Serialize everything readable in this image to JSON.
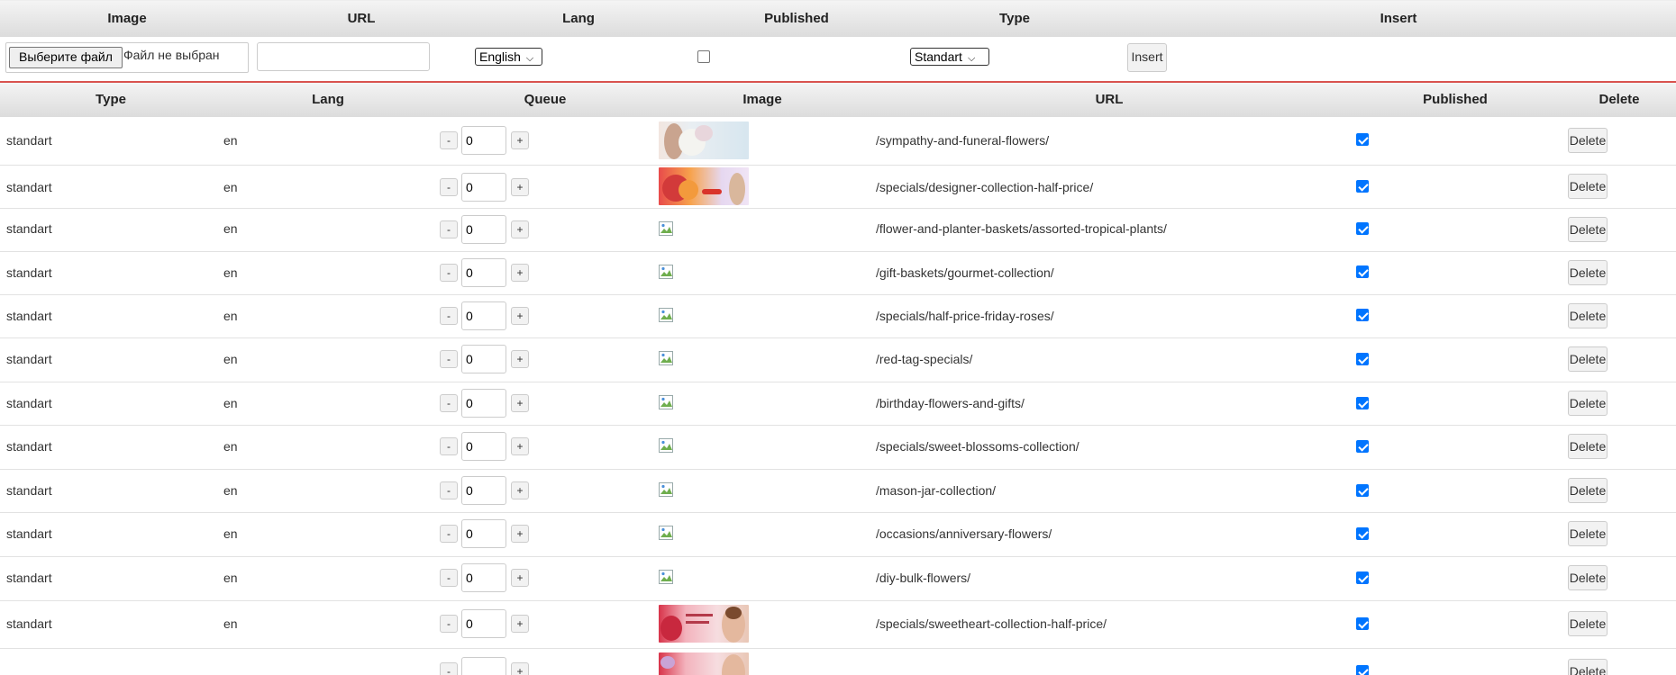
{
  "insert_form": {
    "headers": {
      "image": "Image",
      "url": "URL",
      "lang": "Lang",
      "published": "Published",
      "type": "Type",
      "insert": "Insert"
    },
    "file_button_label": "Выберите файл",
    "file_status": "Файл не выбран",
    "url_value": "",
    "lang_selected": "English",
    "published_checked": false,
    "type_selected": "Standart",
    "insert_button_label": "Insert"
  },
  "list": {
    "headers": {
      "type": "Type",
      "lang": "Lang",
      "queue": "Queue",
      "image": "Image",
      "url": "URL",
      "published": "Published",
      "delete": "Delete"
    },
    "minus_label": "-",
    "plus_label": "+",
    "delete_label": "Delete",
    "rows": [
      {
        "type": "standart",
        "lang": "en",
        "queue": "0",
        "image": "thumb-sympathy",
        "url": "/sympathy-and-funeral-flowers/",
        "published": true
      },
      {
        "type": "standart",
        "lang": "en",
        "queue": "0",
        "image": "thumb-designer",
        "url": "/specials/designer-collection-half-price/",
        "published": true
      },
      {
        "type": "standart",
        "lang": "en",
        "queue": "0",
        "image": "broken-image-icon",
        "url": "/flower-and-planter-baskets/assorted-tropical-plants/",
        "published": true
      },
      {
        "type": "standart",
        "lang": "en",
        "queue": "0",
        "image": "broken-image-icon",
        "url": "/gift-baskets/gourmet-collection/",
        "published": true
      },
      {
        "type": "standart",
        "lang": "en",
        "queue": "0",
        "image": "broken-image-icon",
        "url": "/specials/half-price-friday-roses/",
        "published": true
      },
      {
        "type": "standart",
        "lang": "en",
        "queue": "0",
        "image": "broken-image-icon",
        "url": "/red-tag-specials/",
        "published": true
      },
      {
        "type": "standart",
        "lang": "en",
        "queue": "0",
        "image": "broken-image-icon",
        "url": "/birthday-flowers-and-gifts/",
        "published": true
      },
      {
        "type": "standart",
        "lang": "en",
        "queue": "0",
        "image": "broken-image-icon",
        "url": "/specials/sweet-blossoms-collection/",
        "published": true
      },
      {
        "type": "standart",
        "lang": "en",
        "queue": "0",
        "image": "broken-image-icon",
        "url": "/mason-jar-collection/",
        "published": true
      },
      {
        "type": "standart",
        "lang": "en",
        "queue": "0",
        "image": "broken-image-icon",
        "url": "/occasions/anniversary-flowers/",
        "published": true
      },
      {
        "type": "standart",
        "lang": "en",
        "queue": "0",
        "image": "broken-image-icon",
        "url": "/diy-bulk-flowers/",
        "published": true
      },
      {
        "type": "standart",
        "lang": "en",
        "queue": "0",
        "image": "thumb-sweetheart",
        "url": "/specials/sweetheart-collection-half-price/",
        "published": true
      },
      {
        "type": "",
        "lang": "",
        "queue": "",
        "image": "thumb-partial",
        "url": "",
        "published": true
      }
    ]
  }
}
